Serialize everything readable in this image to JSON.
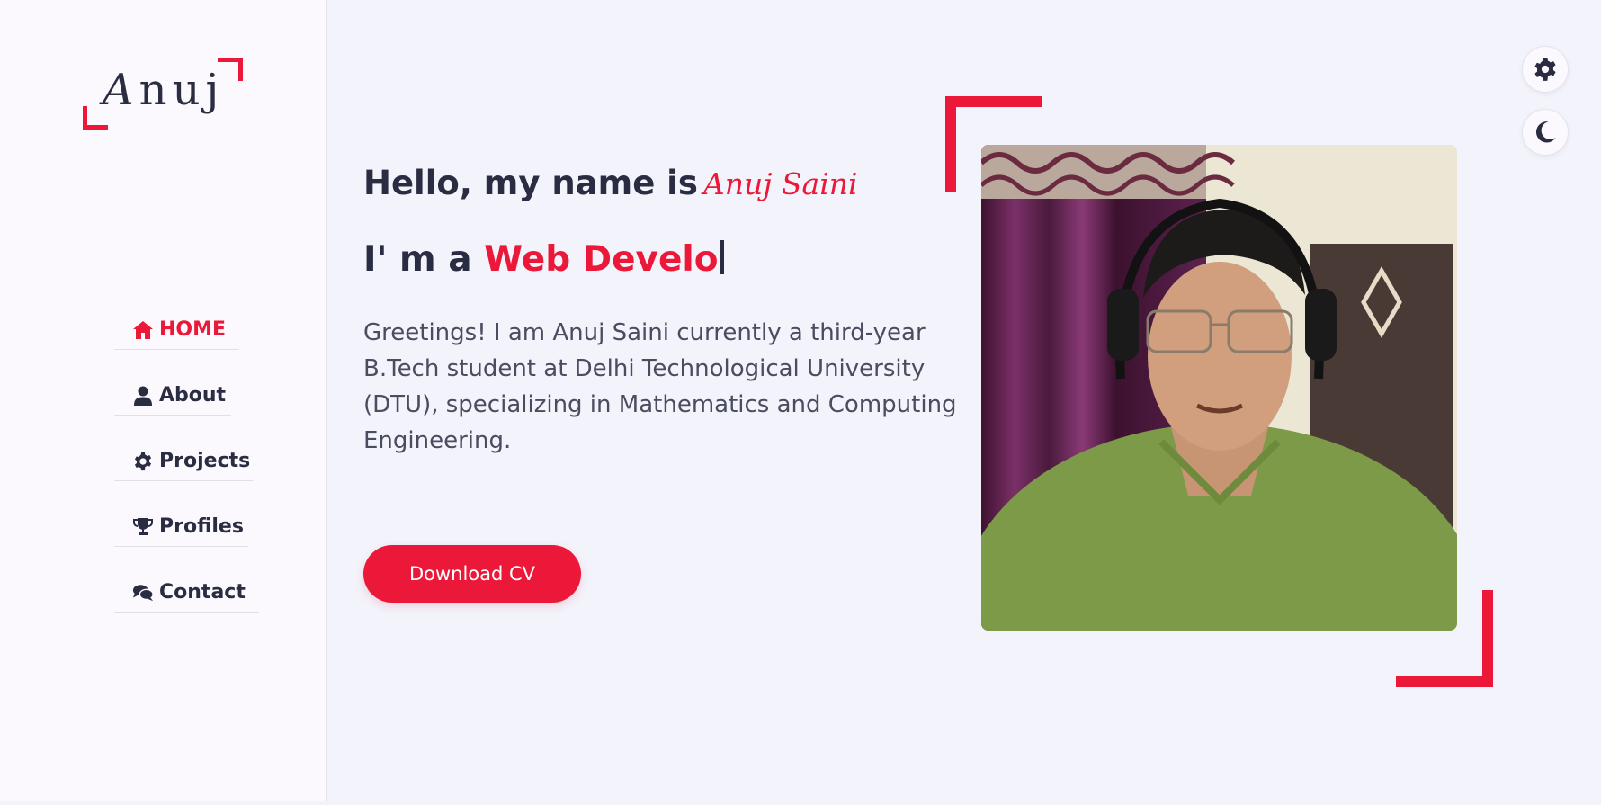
{
  "logo": {
    "first_letter": "A",
    "rest": "nuj"
  },
  "nav": {
    "items": [
      {
        "label": "HOME",
        "icon": "home-icon",
        "active": true
      },
      {
        "label": "About",
        "icon": "user-icon",
        "active": false
      },
      {
        "label": "Projects",
        "icon": "gear-icon",
        "active": false
      },
      {
        "label": "Profiles",
        "icon": "trophy-icon",
        "active": false
      },
      {
        "label": "Contact",
        "icon": "comments-icon",
        "active": false
      }
    ]
  },
  "hero": {
    "hello_prefix": "Hello, my name is",
    "name": "Anuj Saini",
    "role_prefix": "I' m a",
    "role_typed": "Web Develo",
    "intro": "Greetings! I am Anuj Saini currently a third-year B.Tech student at Delhi Technological University (DTU), specializing in Mathematics and Computing Engineering.",
    "cv_button": "Download CV"
  },
  "controls": {
    "settings_icon": "gear-icon",
    "theme_icon": "moon-icon"
  },
  "colors": {
    "accent": "#ec1839",
    "text": "#2a2c42",
    "background": "#f2f3fb",
    "sidebar": "#fbf9fd"
  }
}
